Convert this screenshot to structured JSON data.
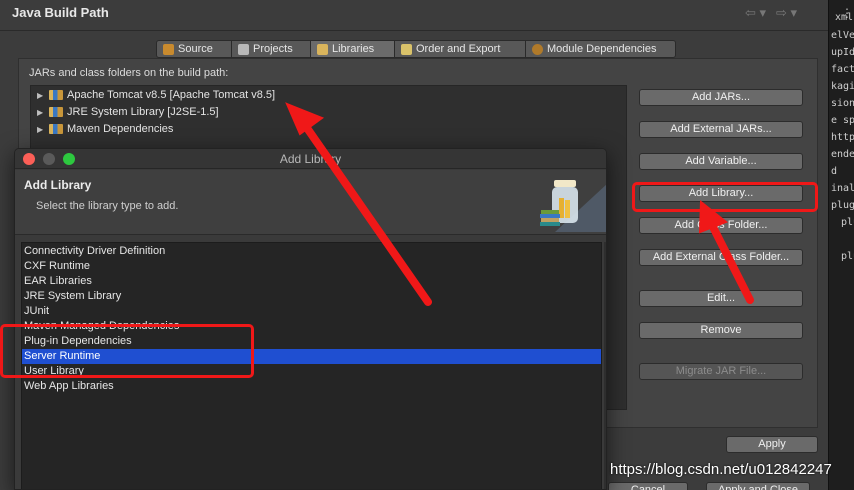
{
  "window": {
    "title": "Java Build Path",
    "nav_back": "⇦ ▾",
    "nav_forward": "⇨ ▾"
  },
  "tabs": [
    {
      "label": "Source",
      "color": "#c88a2e"
    },
    {
      "label": "Projects",
      "color": "#b8b8b8"
    },
    {
      "label": "Libraries",
      "color": "#d9b45c"
    },
    {
      "label": "Order and Export",
      "color": "#d9c26a"
    },
    {
      "label": "Module Dependencies",
      "color": "#b07a2a"
    }
  ],
  "build_path_label": "JARs and class folders on the build path:",
  "tree": [
    {
      "label": "Apache Tomcat v8.5 [Apache Tomcat v8.5]"
    },
    {
      "label": "JRE System Library [J2SE-1.5]"
    },
    {
      "label": "Maven Dependencies"
    }
  ],
  "buttons": {
    "add_jars": "Add JARs...",
    "add_external_jars": "Add External JARs...",
    "add_variable": "Add Variable...",
    "add_library": "Add Library...",
    "add_class_folder": "Add Class Folder...",
    "add_external_class_folder": "Add External Class Folder...",
    "edit": "Edit...",
    "remove": "Remove",
    "migrate_jar": "Migrate JAR File...",
    "apply": "Apply",
    "cancel": "Cancel",
    "apply_and_close": "Apply and Close"
  },
  "dialog": {
    "title": "Add Library",
    "header_title": "Add Library",
    "header_subtitle": "Select the library type to add.",
    "items": [
      "Connectivity Driver Definition",
      "CXF Runtime",
      "EAR Libraries",
      "JRE System Library",
      "JUnit",
      "Maven Managed Dependencies",
      "Plug-in Dependencies",
      "Server Runtime",
      "User Library",
      "Web App Libraries"
    ],
    "selected_index": 7
  },
  "editor_lines": [
    "xml",
    "elVe",
    "upId",
    "facto",
    "kagin",
    "sion",
    "e sp",
    "http",
    "ende",
    "d",
    "inalN",
    "plugi",
    "plu",
    "",
    "plu",
    "",
    "",
    "",
    ""
  ],
  "editor_menu": "⋮",
  "watermark": "https://blog.csdn.net/u012842247",
  "colors": {
    "selection": "#1f4fd1",
    "annotation_red": "#f01818"
  }
}
